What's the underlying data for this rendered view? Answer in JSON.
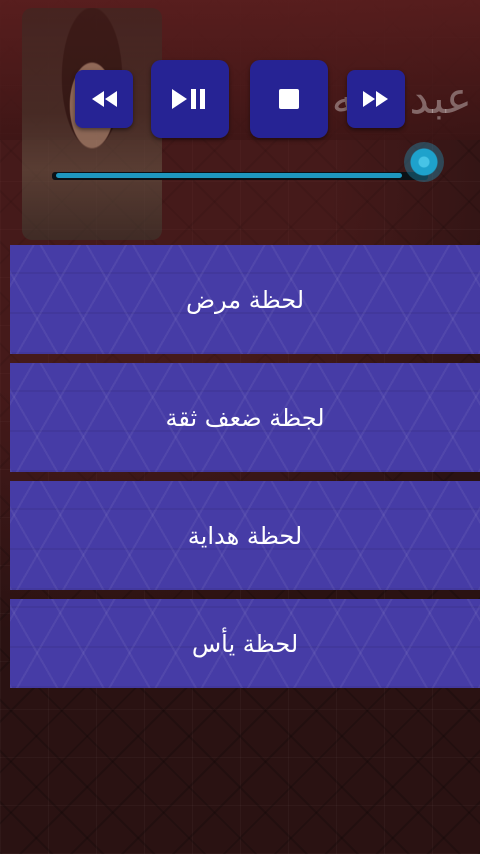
{
  "header": {
    "banner_title": "عبد الله"
  },
  "player": {
    "controls": [
      {
        "name": "rewind",
        "icon": "rewind-icon"
      },
      {
        "name": "play-pause",
        "icon": "play-pause-icon"
      },
      {
        "name": "stop",
        "icon": "stop-icon"
      },
      {
        "name": "fast-forward",
        "icon": "fast-forward-icon"
      }
    ],
    "progress": 0.93
  },
  "menu": {
    "items": [
      {
        "label": "لحظة مرض"
      },
      {
        "label": "لجظة ضعف ثقة"
      },
      {
        "label": "لحظة هداية"
      },
      {
        "label": "لحظة يأس"
      }
    ]
  },
  "colors": {
    "control_button": "#262394",
    "menu_button": "#463ca6",
    "seek_accent": "#1e97bf",
    "background": "#2a1212"
  }
}
